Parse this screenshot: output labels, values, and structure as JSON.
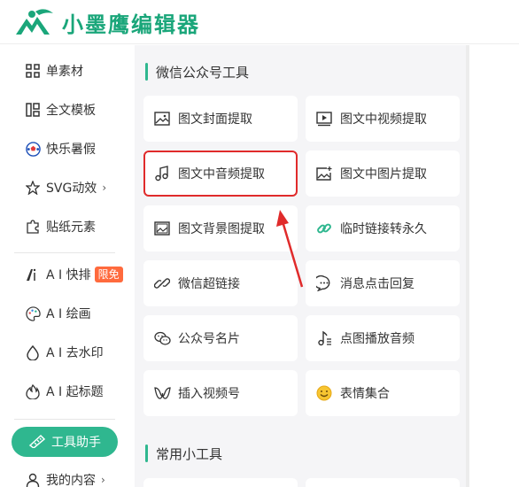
{
  "brand": {
    "name": "小墨鹰编辑器",
    "color": "#1aa67a"
  },
  "sidebar": {
    "items": [
      {
        "label": "单素材",
        "icon": "grid-icon"
      },
      {
        "label": "全文模板",
        "icon": "layout-icon"
      },
      {
        "label": "快乐暑假",
        "icon": "soccer-ball-icon"
      },
      {
        "label": "SVG动效",
        "icon": "star-icon",
        "chevron": "›"
      },
      {
        "label": "贴纸元素",
        "icon": "puzzle-icon"
      },
      {
        "label": "A I 快排",
        "icon": "ai-icon",
        "badge": "限免"
      },
      {
        "label": "A I 绘画",
        "icon": "palette-icon"
      },
      {
        "label": "A I 去水印",
        "icon": "drop-icon"
      },
      {
        "label": "A I 起标题",
        "icon": "flame-icon"
      },
      {
        "label": "工具助手",
        "icon": "ruler-icon"
      },
      {
        "label": "我的内容",
        "icon": "user-icon",
        "chevron": "›"
      }
    ]
  },
  "sections": [
    {
      "title": "微信公众号工具"
    },
    {
      "title": "常用小工具"
    }
  ],
  "cards": [
    {
      "label": "图文封面提取",
      "icon": "image-icon"
    },
    {
      "label": "图文中视频提取",
      "icon": "video-icon"
    },
    {
      "label": "图文中音频提取",
      "icon": "music-note-icon"
    },
    {
      "label": "图文中图片提取",
      "icon": "image-plus-icon"
    },
    {
      "label": "图文背景图提取",
      "icon": "background-image-icon"
    },
    {
      "label": "临时链接转永久",
      "icon": "link-icon"
    },
    {
      "label": "微信超链接",
      "icon": "chain-icon"
    },
    {
      "label": "消息点击回复",
      "icon": "chat-icon"
    },
    {
      "label": "公众号名片",
      "icon": "wechat-icon"
    },
    {
      "label": "点图播放音频",
      "icon": "audio-note-icon"
    },
    {
      "label": "插入视频号",
      "icon": "channels-icon"
    },
    {
      "label": "表情集合",
      "icon": "smiley-icon"
    }
  ],
  "colors": {
    "accent": "#2fb78f",
    "highlight": "#e02b2b",
    "badge": "#ff6a3d"
  }
}
